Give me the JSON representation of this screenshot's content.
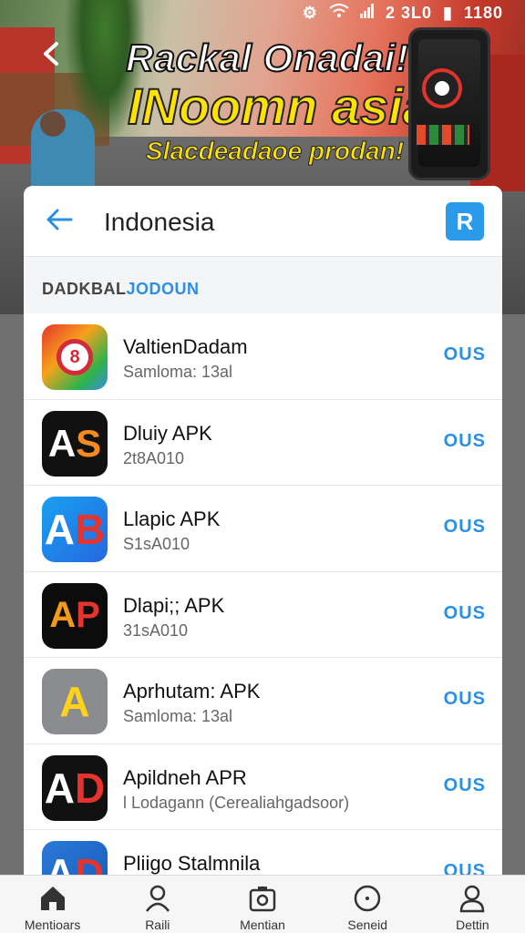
{
  "status_bar": {
    "icons": [
      "app-icon",
      "wifi-icon",
      "signal-icon"
    ],
    "right_text": "2 3L0",
    "battery": "▮",
    "time": "1180"
  },
  "banner": {
    "line1": "Rackal Onadai!",
    "line2": "INoomn asia",
    "line3": "Slacdeadaoe prodan!",
    "back_icon": "back-arrow-icon"
  },
  "header": {
    "title": "Indonesia",
    "action_label": "R",
    "back_icon": "back-arrow-icon"
  },
  "section": {
    "prefix": "DADKBAL",
    "accent": "JODOUN"
  },
  "apps": [
    {
      "name": "ValtienDadam",
      "sub": "Samloma: 13al",
      "action": "OUS",
      "icon": "app-icon-shield",
      "glyph": "8"
    },
    {
      "name": "Dluiy APK",
      "sub": "2t8A010",
      "action": "OUS",
      "icon": "app-icon-as",
      "glyph": "A",
      "glyph_b": "S"
    },
    {
      "name": "Llapic APK",
      "sub": "S1sA010",
      "action": "OUS",
      "icon": "app-icon-ab",
      "glyph": "A",
      "glyph_b": "B"
    },
    {
      "name": "Dlapi;; APK",
      "sub": "31sA010",
      "action": "OUS",
      "icon": "app-icon-ap",
      "glyph": "A",
      "glyph_b": "P"
    },
    {
      "name": "Aprhutam: APK",
      "sub": "Samloma: 13al",
      "action": "OUS",
      "icon": "app-icon-ad-yellow",
      "glyph": "A"
    },
    {
      "name": "Apildneh APR",
      "sub": "l Lodagann (Cerealiahgadsoor)",
      "action": "OUS",
      "icon": "app-icon-ad-red",
      "glyph": "A",
      "glyph_b": "D"
    },
    {
      "name": "Pliigo Stalmnila",
      "sub": "",
      "action": "OUS",
      "icon": "app-icon-ad-blue",
      "glyph": "A",
      "glyph_b": "D"
    }
  ],
  "nav": [
    {
      "label": "Mentioars",
      "icon": "home-icon"
    },
    {
      "label": "Raili",
      "icon": "person-icon"
    },
    {
      "label": "Mentian",
      "icon": "camera-icon"
    },
    {
      "label": "Seneid",
      "icon": "chat-icon"
    },
    {
      "label": "Dettin",
      "icon": "profile-icon"
    }
  ],
  "colors": {
    "accent": "#2b8fe6",
    "headline_yellow": "#ffe200"
  }
}
